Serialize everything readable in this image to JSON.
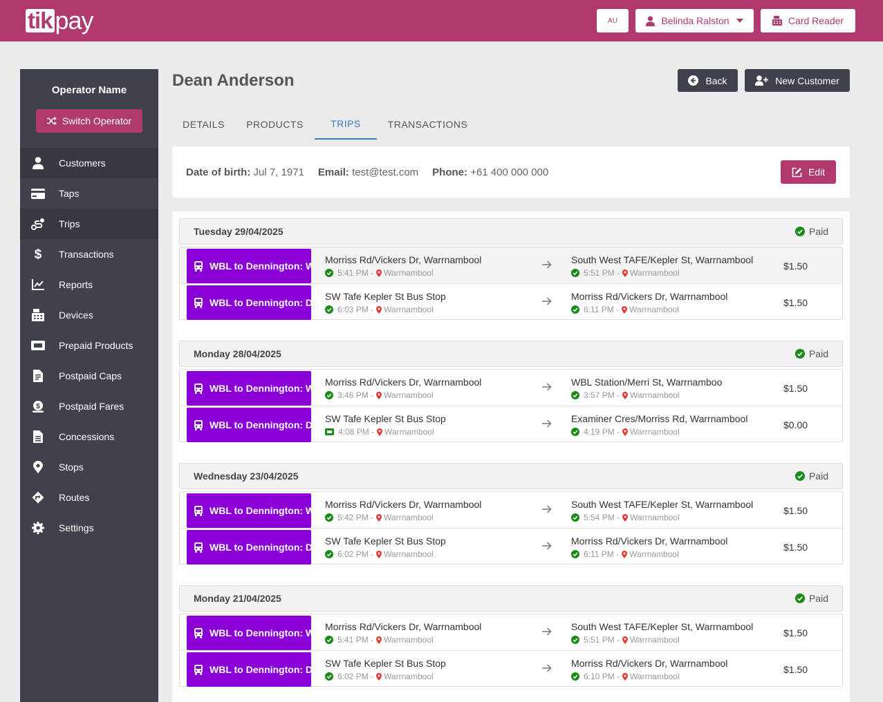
{
  "brand": {
    "logo_box": "tik",
    "logo_rest": "pay"
  },
  "header": {
    "region": "AU",
    "user_name": "Belinda Ralston",
    "card_reader_label": "Card Reader"
  },
  "colors": {
    "brand": "#b03a6e",
    "sidebar": "#3f424c",
    "route": "#8b00d6",
    "tab_active": "#3a78c0",
    "success": "#1a8a1a",
    "pin": "#e53935"
  },
  "sidebar": {
    "operator_name": "Operator Name",
    "switch_label": "Switch Operator",
    "items": [
      {
        "label": "Customers",
        "icon": "user-icon"
      },
      {
        "label": "Taps",
        "icon": "card-icon"
      },
      {
        "label": "Trips",
        "icon": "route-icon"
      },
      {
        "label": "Transactions",
        "icon": "dollar-icon"
      },
      {
        "label": "Reports",
        "icon": "chart-line-icon"
      },
      {
        "label": "Devices",
        "icon": "cash-register-icon"
      },
      {
        "label": "Prepaid Products",
        "icon": "ticket-icon"
      },
      {
        "label": "Postpaid Caps",
        "icon": "invoice-icon"
      },
      {
        "label": "Postpaid Fares",
        "icon": "coin-icon"
      },
      {
        "label": "Concessions",
        "icon": "document-icon"
      },
      {
        "label": "Stops",
        "icon": "map-pin-icon"
      },
      {
        "label": "Routes",
        "icon": "directions-icon"
      },
      {
        "label": "Settings",
        "icon": "gear-icon"
      }
    ]
  },
  "customer": {
    "name": "Dean Anderson",
    "back_label": "Back",
    "new_customer_label": "New Customer",
    "tabs": [
      "DETAILS",
      "PRODUCTS",
      "TRIPS",
      "TRANSACTIONS"
    ],
    "active_tab": "TRIPS",
    "dob_label": "Date of birth:",
    "dob": "Jul 7, 1971",
    "email_label": "Email:",
    "email": "test@test.com",
    "phone_label": "Phone:",
    "phone": "+61 400 000 000",
    "edit_label": "Edit"
  },
  "days": [
    {
      "date": "Tuesday 29/04/2025",
      "status": "Paid",
      "trips": [
        {
          "route": "WBL to Dennington: Warrnambool",
          "from": "Morriss Rd/Vickers Dr, Warrnambool",
          "from_time": "5:41 PM",
          "from_town": "Warrnambool",
          "from_icon": "check-circle-icon",
          "to": "South West TAFE/Kepler St, Warrnambool",
          "to_time": "5:51 PM",
          "to_town": "Warrnambool",
          "price": "$1.50"
        },
        {
          "route": "WBL to Dennington: Dennington",
          "from": "SW Tafe Kepler St Bus Stop",
          "from_time": "6:03 PM",
          "from_town": "Warrnambool",
          "from_icon": "check-circle-icon",
          "to": "Morriss Rd/Vickers Dr, Warrnambool",
          "to_time": "6:11 PM",
          "to_town": "Warrnambool",
          "price": "$1.50"
        }
      ]
    },
    {
      "date": "Monday 28/04/2025",
      "status": "Paid",
      "trips": [
        {
          "route": "WBL to Dennington: Warrnambool",
          "from": "Morriss Rd/Vickers Dr, Warrnambool",
          "from_time": "3:46 PM",
          "from_town": "Warrnambool",
          "from_icon": "check-circle-icon",
          "to": "WBL Station/Merri St, Warrnamboo",
          "to_time": "3:57 PM",
          "to_town": "Warrnambool",
          "price": "$1.50"
        },
        {
          "route": "WBL to Dennington: Dennington",
          "from": "SW Tafe Kepler St Bus Stop",
          "from_time": "4:08 PM",
          "from_town": "Warrnambool",
          "from_icon": "ticket-icon",
          "to": "Examiner Cres/Morriss Rd, Warrnambool",
          "to_time": "4:19 PM",
          "to_town": "Warrnambool",
          "price": "$0.00"
        }
      ]
    },
    {
      "date": "Wednesday 23/04/2025",
      "status": "Paid",
      "trips": [
        {
          "route": "WBL to Dennington: Warrnambool",
          "from": "Morriss Rd/Vickers Dr, Warrnambool",
          "from_time": "5:42 PM",
          "from_town": "Warrnambool",
          "from_icon": "check-circle-icon",
          "to": "South West TAFE/Kepler St, Warrnambool",
          "to_time": "5:54 PM",
          "to_town": "Warrnambool",
          "price": "$1.50"
        },
        {
          "route": "WBL to Dennington: Dennington",
          "from": "SW Tafe Kepler St Bus Stop",
          "from_time": "6:02 PM",
          "from_town": "Warrnambool",
          "from_icon": "check-circle-icon",
          "to": "Morriss Rd/Vickers Dr, Warrnambool",
          "to_time": "6:11 PM",
          "to_town": "Warrnambool",
          "price": "$1.50"
        }
      ]
    },
    {
      "date": "Monday 21/04/2025",
      "status": "Paid",
      "trips": [
        {
          "route": "WBL to Dennington: Warrnambool",
          "from": "Morriss Rd/Vickers Dr, Warrnambool",
          "from_time": "5:41 PM",
          "from_town": "Warrnambool",
          "from_icon": "check-circle-icon",
          "to": "South West TAFE/Kepler St, Warrnambool",
          "to_time": "5:51 PM",
          "to_town": "Warrnambool",
          "price": "$1.50"
        },
        {
          "route": "WBL to Dennington: Dennington",
          "from": "SW Tafe Kepler St Bus Stop",
          "from_time": "6:02 PM",
          "from_town": "Warrnambool",
          "from_icon": "check-circle-icon",
          "to": "Morriss Rd/Vickers Dr, Warrnambool",
          "to_time": "6:10 PM",
          "to_town": "Warrnambool",
          "price": "$1.50"
        }
      ]
    }
  ]
}
